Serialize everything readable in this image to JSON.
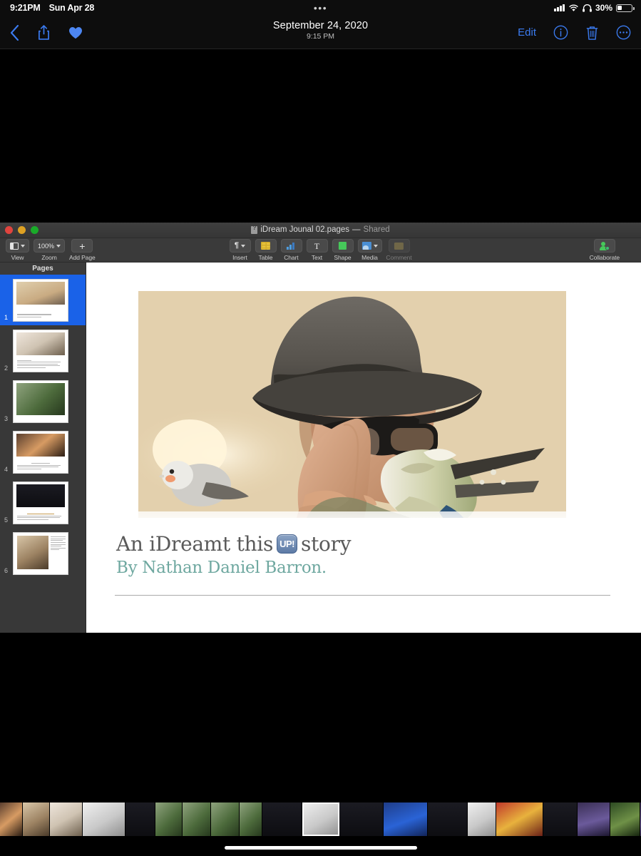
{
  "status_bar": {
    "time": "9:21PM",
    "date": "Sun Apr 28",
    "center_dots": "•••",
    "battery_percent": "30%",
    "icons": [
      "cellular-signal-icon",
      "wifi-icon",
      "headphones-icon",
      "battery-icon"
    ]
  },
  "photos_nav": {
    "back_icon": "chevron-left-icon",
    "share_icon": "share-icon",
    "favorite_icon": "heart-icon",
    "title_date": "September 24, 2020",
    "title_time": "9:15 PM",
    "edit_label": "Edit",
    "info_icon": "info-circle-icon",
    "trash_icon": "trash-icon",
    "more_icon": "ellipsis-circle-icon",
    "accent_color": "#3b7bf0"
  },
  "pages_window": {
    "title": "iDream Jounal 02.pages",
    "title_separator": "—",
    "shared_label": "Shared",
    "traffic_lights": [
      "close-button",
      "minimize-button",
      "zoom-button"
    ],
    "toolbar": {
      "left": [
        {
          "label": "View",
          "icon": "view-icon",
          "has_chevron": true
        },
        {
          "label": "Zoom",
          "icon": "zoom-level",
          "value": "100%",
          "has_chevron": true
        },
        {
          "label": "Add Page",
          "icon": "plus-icon",
          "has_chevron": false
        }
      ],
      "center": [
        {
          "label": "Insert",
          "icon": "paragraph-icon",
          "has_chevron": true
        },
        {
          "label": "Table",
          "icon": "table-icon",
          "has_chevron": false
        },
        {
          "label": "Chart",
          "icon": "chart-icon",
          "has_chevron": false
        },
        {
          "label": "Text",
          "icon": "text-icon",
          "has_chevron": false
        },
        {
          "label": "Shape",
          "icon": "shape-icon",
          "has_chevron": false
        },
        {
          "label": "Media",
          "icon": "media-icon",
          "has_chevron": true
        },
        {
          "label": "Comment",
          "icon": "comment-icon",
          "has_chevron": false,
          "disabled": true
        }
      ],
      "right": [
        {
          "label": "Collaborate",
          "icon": "collaborate-icon",
          "has_chevron": false
        }
      ]
    },
    "sidebar": {
      "header": "Pages",
      "selection_color": "#1a62e8",
      "thumbnails": [
        {
          "number": "1",
          "selected": true,
          "swatch": "p1"
        },
        {
          "number": "2",
          "selected": false,
          "swatch": "p2"
        },
        {
          "number": "3",
          "selected": false,
          "swatch": "p3"
        },
        {
          "number": "4",
          "selected": false,
          "swatch": "p4"
        },
        {
          "number": "5",
          "selected": false,
          "swatch": "p5"
        },
        {
          "number": "6",
          "selected": false,
          "swatch": "p6"
        }
      ]
    },
    "document": {
      "headline_before": "An iDreamt this",
      "headline_badge": "UP!",
      "headline_after": "story",
      "byline": "By Nathan Daniel Barron.",
      "headline_color": "#5a5a5a",
      "byline_color": "#6fa8a0",
      "photo_alt": "man-in-fedora-with-two-cockatiels-photo"
    }
  },
  "filmstrip": {
    "selected_index": 8,
    "items": [
      {
        "swatch": "p4"
      },
      {
        "swatch": "p6"
      },
      {
        "swatch": "p2"
      },
      {
        "swatch": "p11"
      },
      {
        "swatch": "p5"
      },
      {
        "swatch": "p3"
      },
      {
        "swatch": "p3"
      },
      {
        "swatch": "p5"
      },
      {
        "swatch": "p1"
      },
      {
        "swatch": "p5"
      },
      {
        "swatch": "p7"
      },
      {
        "swatch": "p5"
      },
      {
        "swatch": "p11"
      },
      {
        "swatch": "p8"
      },
      {
        "swatch": "p5"
      },
      {
        "swatch": "p9"
      },
      {
        "swatch": "p10"
      },
      {
        "swatch": "p9"
      },
      {
        "swatch": "p10"
      },
      {
        "swatch": "p12"
      }
    ]
  },
  "home_indicator": "home-indicator"
}
